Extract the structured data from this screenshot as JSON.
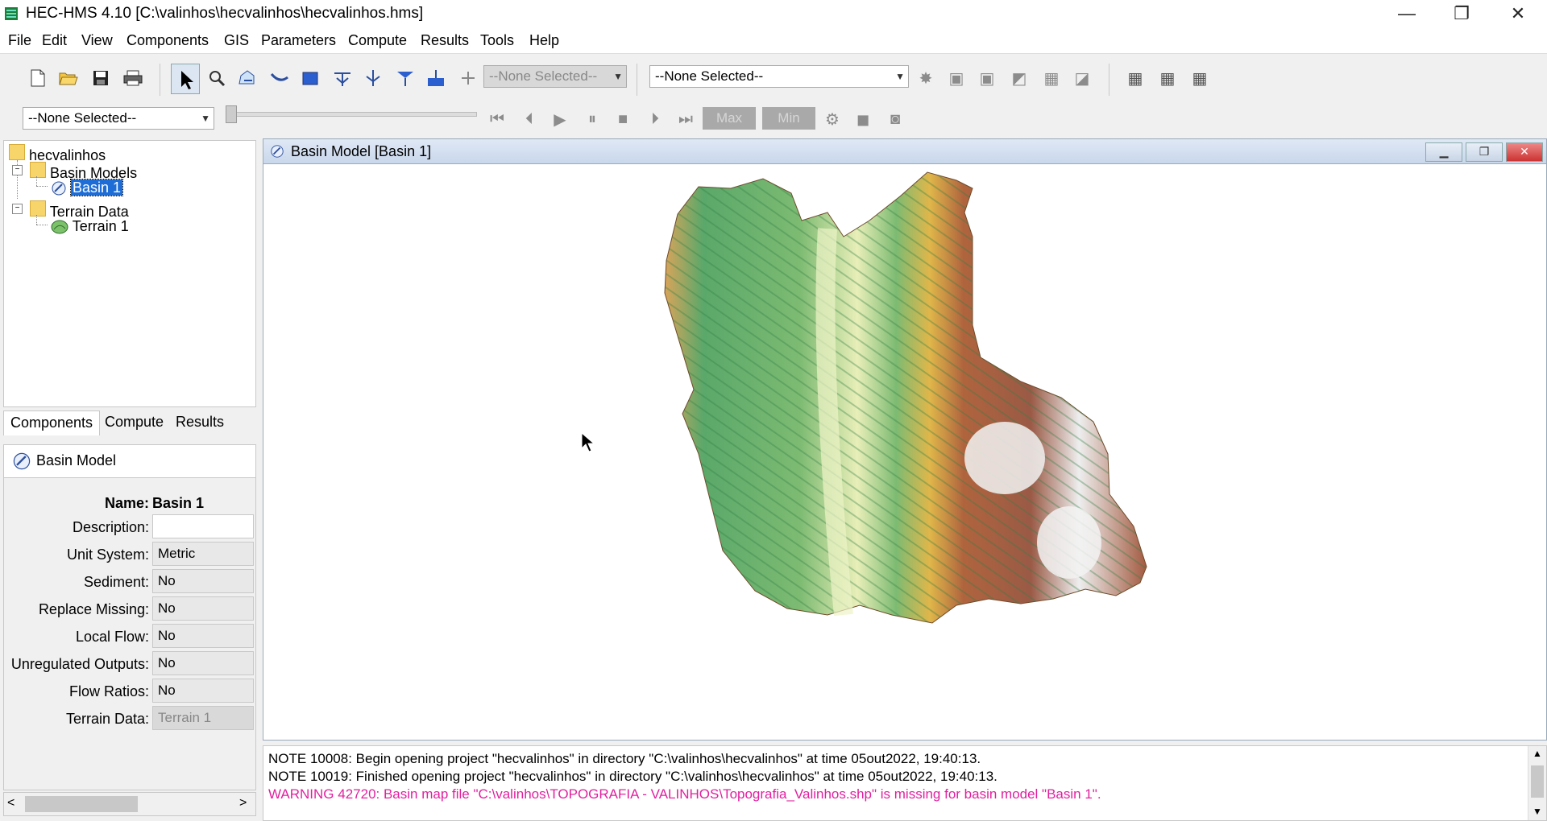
{
  "window": {
    "title": "HEC-HMS 4.10 [C:\\valinhos\\hecvalinhos\\hecvalinhos.hms]",
    "minimize": "—",
    "restore": "❐",
    "close": "✕"
  },
  "menu": [
    "File",
    "Edit",
    "View",
    "Components",
    "GIS",
    "Parameters",
    "Compute",
    "Results",
    "Tools",
    "Help"
  ],
  "toolbar": {
    "combo_small": "--None Selected--",
    "combo_large": "--None Selected--",
    "combo_time": "--None Selected--",
    "max_label": "Max",
    "min_label": "Min"
  },
  "tree": {
    "root": "hecvalinhos",
    "basin_models": "Basin Models",
    "basin1": "Basin 1",
    "terrain_data": "Terrain Data",
    "terrain1": "Terrain 1"
  },
  "tabs": [
    "Components",
    "Compute",
    "Results"
  ],
  "props": {
    "header": "Basin Model",
    "name_label": "Name:",
    "name_value": "Basin 1",
    "rows": [
      {
        "label": "Description:",
        "value": ""
      },
      {
        "label": "Unit System:",
        "value": "Metric"
      },
      {
        "label": "Sediment:",
        "value": "No"
      },
      {
        "label": "Replace Missing:",
        "value": "No"
      },
      {
        "label": "Local Flow:",
        "value": "No"
      },
      {
        "label": "Unregulated Outputs:",
        "value": "No"
      },
      {
        "label": "Flow Ratios:",
        "value": "No"
      },
      {
        "label": "Terrain Data:",
        "value": "Terrain 1"
      }
    ]
  },
  "basin_window": {
    "title": "Basin Model [Basin 1]"
  },
  "console": [
    "NOTE 10008:  Begin opening project \"hecvalinhos\" in directory \"C:\\valinhos\\hecvalinhos\" at time 05out2022, 19:40:13.",
    "NOTE 10019:  Finished opening project \"hecvalinhos\" in directory \"C:\\valinhos\\hecvalinhos\" at time 05out2022, 19:40:13.",
    "WARNING 42720:  Basin map file \"C:\\valinhos\\TOPOGRAFIA - VALINHOS\\Topografia_Valinhos.shp\" is missing for basin model \"Basin 1\"."
  ],
  "colors": {
    "warning": "#e0209f",
    "selection": "#1e6dd6",
    "terrain_low": "#d9ecc8",
    "terrain_mid": "#5bab6e",
    "terrain_high": "#a0523d",
    "terrain_peak": "#f2f2f2"
  }
}
